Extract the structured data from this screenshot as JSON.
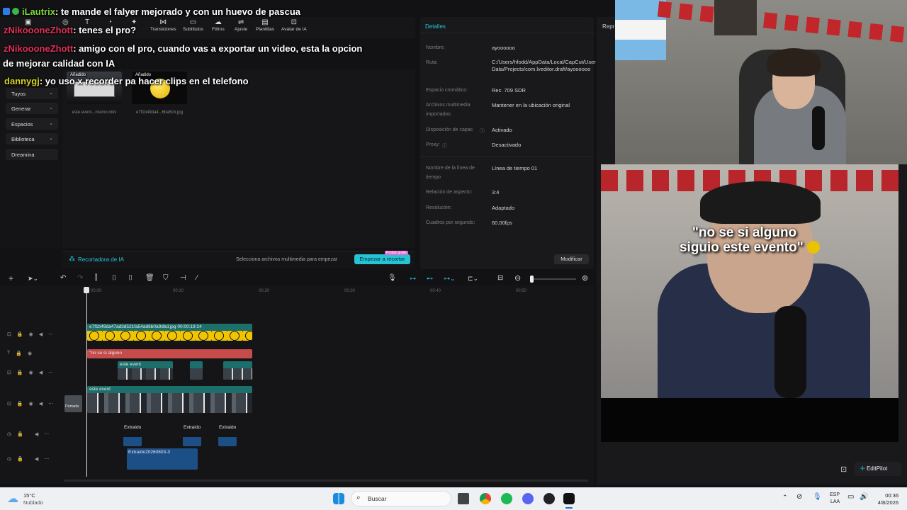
{
  "chat": [
    {
      "user": "iLautrix",
      "user_color": "#7fd83a",
      "message": ": te mande el falyer mejorado y con un huevo de pascua"
    },
    {
      "user": "zNikoooneZhott",
      "user_color": "#e0315a",
      "message": ": tenes el pro?"
    },
    {
      "user": "zNikoooneZhott",
      "user_color": "#e0315a",
      "message": ": amigo con el pro, cuando vas a exportar un video, esta la opcion"
    },
    {
      "user": "",
      "user_color": "#ffffff",
      "message": "de mejorar calidad con IA"
    },
    {
      "user": "dannygj",
      "user_color": "#d6d321",
      "message": ": yo uso x recorder pa hacer clips en el telefono"
    }
  ],
  "toolbar": {
    "items": [
      "Transiciones",
      "Subtítulos",
      "Filtros",
      "Ajuste",
      "Plantillas",
      "Avatar de IA"
    ]
  },
  "leftnav": {
    "items": [
      "Tuyos",
      "Generar",
      "Espacios",
      "Biblioteca",
      "Dreamina"
    ]
  },
  "media": {
    "added_tag": "Añadido",
    "files": [
      {
        "name": "este event...nisimo.mkv"
      },
      {
        "name": "e7f1b49da4...6ba5cb.jpg"
      }
    ]
  },
  "recorder": {
    "title": "Recortadora de IA",
    "hint": "Selecciona archivos multimedia para empezar",
    "button": "Empezar a recortar",
    "badge": "Probar gratis"
  },
  "details": {
    "title": "Detalles",
    "rows": [
      {
        "label": "Nombre:",
        "value": "ayoooooo"
      },
      {
        "label": "Ruta:",
        "value": "C:/Users/hfodd/AppData/Local/CapCut/User Data/Projects/com.lveditor.draft/ayoooooo"
      },
      {
        "label": "Espacio cromático:",
        "value": "Rec. 709 SDR"
      },
      {
        "label": "Archivos multimedia importados:",
        "value": "Mantener en la ubicación original"
      },
      {
        "label": "Disposición de capas",
        "value": "Activado"
      },
      {
        "label": "Proxy:",
        "value": "Desactivado"
      },
      {
        "label": "Nombre de la línea de tiempo",
        "value": "Línea de tiempo 01"
      },
      {
        "label": "Relación de aspecto:",
        "value": "3:4"
      },
      {
        "label": "Resolución:",
        "value": "Adaptado"
      },
      {
        "label": "Cuadros por segundo:",
        "value": "60.00fps"
      }
    ],
    "modify_button": "Modificar"
  },
  "timeline": {
    "ruler": [
      "00:00",
      "00:10",
      "00:20",
      "00:30",
      "00:40",
      "00:50"
    ],
    "image_clip": "e7f1b49da47ad3d521fa54ad6b0a9dbd.jpg  00:00:19:24",
    "text_clip": "\"no se si alguno",
    "video_clip_label": "este event",
    "cover_label": "Portada",
    "audio_label": "Extraído",
    "audio_clip_long": "Extraído20260803-3"
  },
  "stream": {
    "caption_line1": "\"no se si alguno",
    "caption_line2": "siguio este evento\"",
    "partial_label": "Repr"
  },
  "editpilot": {
    "label": "EditPilot"
  },
  "taskbar": {
    "temp": "15°C",
    "weather": "Nublado",
    "search": "Buscar",
    "lang": "ESP",
    "lang2": "LAA",
    "time": "00:36",
    "date": "4/8/2026"
  },
  "colors": {
    "accent": "#25c3d3",
    "clip_teal": "#1d6f6b",
    "text_clip": "#c64b4b",
    "audio_clip": "#1c4f86"
  }
}
